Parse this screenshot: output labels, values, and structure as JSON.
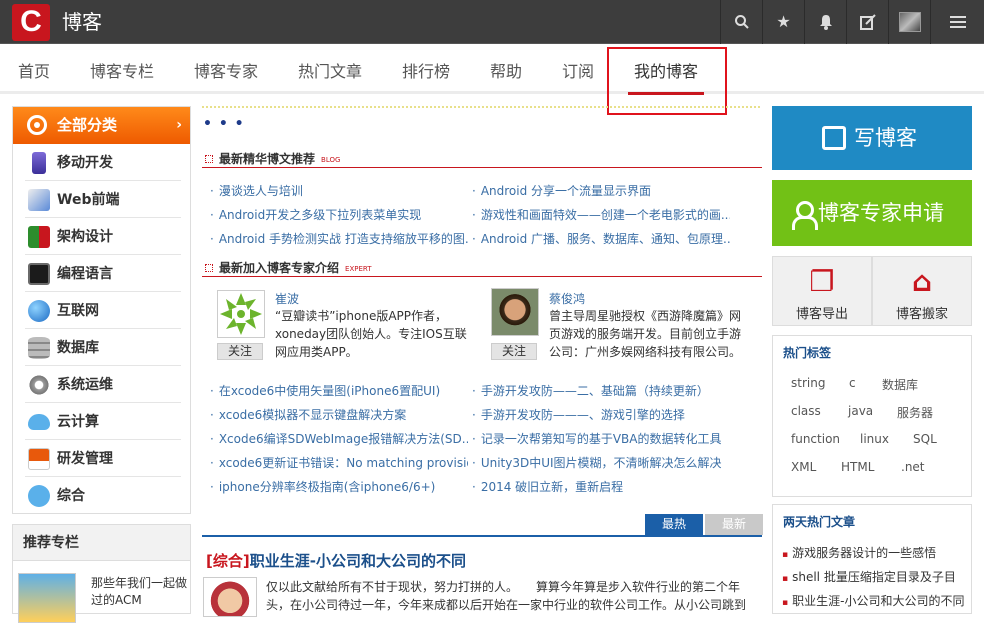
{
  "topbar": {
    "logo_letter": "C",
    "brand": "博客",
    "icons": [
      "search-icon",
      "star-icon",
      "bell-icon",
      "edit-icon",
      "avatar",
      "menu-icon"
    ]
  },
  "nav": {
    "items": [
      "首页",
      "博客专栏",
      "博客专家",
      "热门文章",
      "排行榜",
      "帮助",
      "订阅",
      "我的博客"
    ],
    "active": "我的博客"
  },
  "categories": {
    "header": "全部分类",
    "arrow": "›",
    "items": [
      "移动开发",
      "Web前端",
      "架构设计",
      "编程语言",
      "互联网",
      "数据库",
      "系统运维",
      "云计算",
      "研发管理",
      "综合"
    ]
  },
  "recommend": {
    "title": "推荐专栏",
    "item_text": "那些年我们一起做过的ACM"
  },
  "center": {
    "dots": "• • •",
    "featured": {
      "title": "最新精华博文推荐",
      "tag": "BLOG",
      "left": [
        "漫谈选人与培训",
        "Android开发之多级下拉列表菜单实现",
        "Android 手势检测实战 打造支持缩放平移的图..."
      ],
      "right": [
        "Android 分享一个流量显示界面",
        "游戏性和画面特效——创建一个老电影式的画...",
        "Android 广播、服务、数据库、通知、包原理..."
      ]
    },
    "experts": {
      "title": "最新加入博客专家介绍",
      "tag": "EXPERT",
      "follow_label": "关注",
      "list": [
        {
          "name": "崔波",
          "desc": "“豆瓣读书”iphone版APP作者，xoneday团队创始人。专注IOS互联网应用类APP。"
        },
        {
          "name": "蔡俊鸿",
          "desc": "曾主导周星驰授权《西游降魔篇》网页游戏的服务端开发。目前创立手游公司：广州多娱网络科技有限公司。"
        }
      ]
    },
    "expert_links": {
      "left": [
        "在xcode6中使用矢量图(iPhone6置配UI)",
        "xcode6模拟器不显示键盘解决方案",
        "Xcode6编译SDWebImage报错解决方法(SD...",
        "xcode6更新证书错误：No matching provisio...",
        "iphone分辨率终极指南(含iphone6/6+)"
      ],
      "right": [
        "手游开发攻防——二、基础篇（持续更新）",
        "手游开发攻防———、游戏引擎的选择",
        "记录一次帮第知写的基于VBA的数据转化工具",
        "Unity3D中UI图片模糊，不清晰解决怎么解决",
        "2014 破旧立新，重新启程"
      ]
    },
    "tabs": {
      "hot": "最热",
      "new": "最新"
    },
    "article": {
      "category": "[综合]",
      "title": "职业生涯-小公司和大公司的不同",
      "excerpt": "仅以此文献给所有不甘于现状，努力打拼的人。　　算算今年算是步入软件行业的第二个年头，在小公司待过一年，今年来成都以后开始在一家中行业的软件公司工作。从小公司跳到"
    }
  },
  "right": {
    "write_label": "写博客",
    "apply_label": "博客专家申请",
    "export_label": "博客导出",
    "move_label": "博客搬家",
    "tags_title": "热门标签",
    "tags": [
      "string",
      "c",
      "数据库",
      "class",
      "java",
      "服务器",
      "function",
      "linux",
      "SQL",
      "XML",
      "HTML",
      ".net"
    ],
    "hot_title": "两天热门文章",
    "hot_articles": [
      "游戏服务器设计的一些感悟",
      "shell 批量压缩指定目录及子目",
      "职业生涯-小公司和大公司的不同"
    ]
  }
}
